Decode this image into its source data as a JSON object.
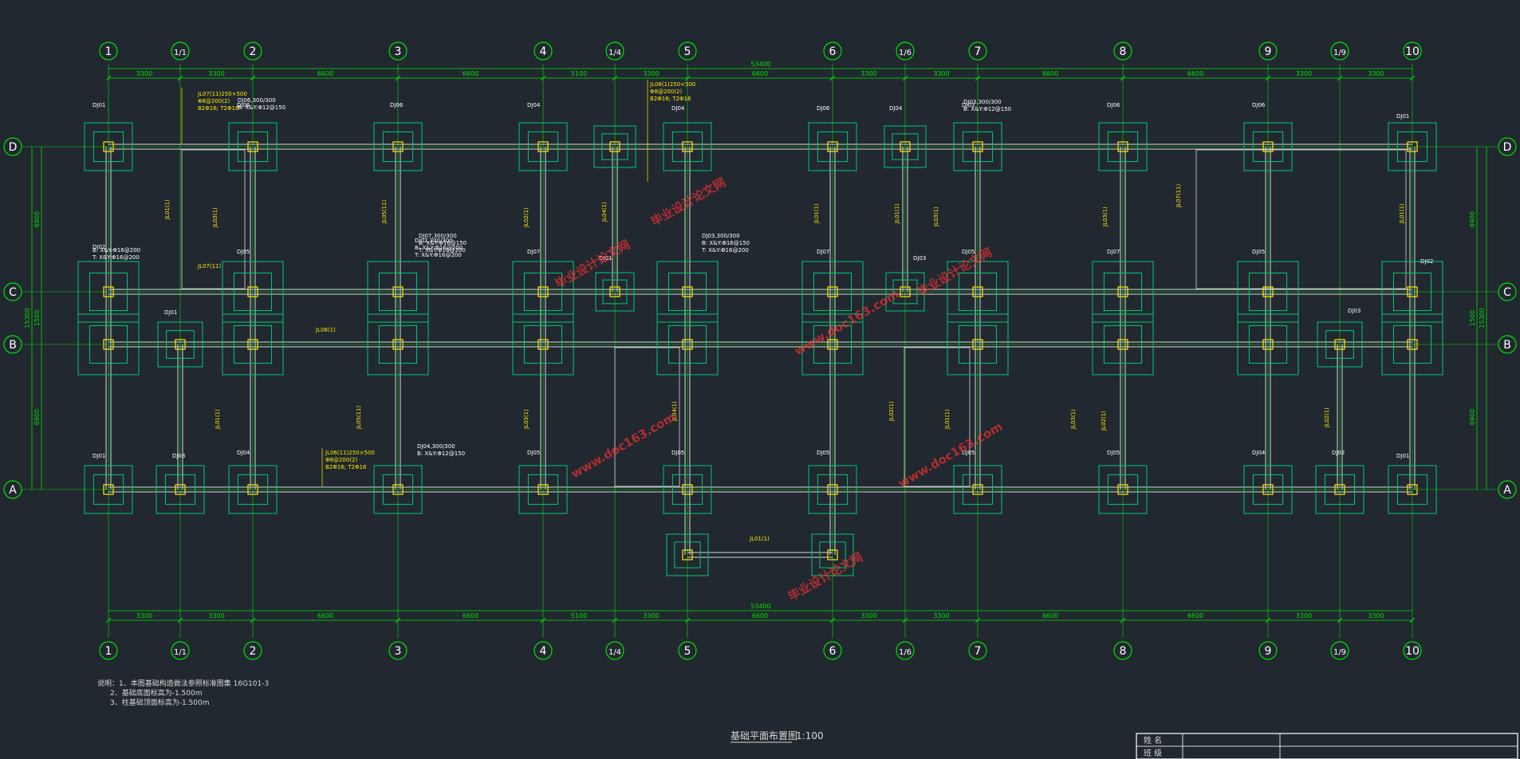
{
  "drawing": {
    "title": "基础平面布置图",
    "scale": "1:100",
    "notes": [
      "说明：1、本图基础构造做法参照标准图集 16G101-3",
      "2、基础底面标高为-1.500m",
      "3、柱基础顶面标高为-1.500m"
    ],
    "title_block": [
      "姓 名",
      "班 级"
    ],
    "watermarks": [
      "毕业设计论文网",
      "www.doc163.com"
    ]
  },
  "axes": {
    "columns": [
      "1",
      "1/1",
      "2",
      "3",
      "4",
      "1/4",
      "5",
      "6",
      "1/6",
      "7",
      "8",
      "9",
      "1/9",
      "10"
    ],
    "rows": [
      "D",
      "C",
      "B",
      "A"
    ]
  },
  "dimensions": {
    "total": "53400",
    "spans": [
      "3300",
      "3300",
      "6600",
      "6600",
      "5100",
      "3300",
      "6600",
      "3300",
      "3300",
      "6600",
      "6600",
      "3300",
      "3300"
    ],
    "row_spans": [
      "6900",
      "1500",
      "6900"
    ],
    "row_total": "15300"
  },
  "labels": {
    "footings": [
      "DJ01",
      "DJ02",
      "DJ03",
      "DJ04",
      "DJ05",
      "DJ06",
      "DJ07",
      "DJ08"
    ],
    "beams": [
      "JL01(1)",
      "JL02(1)",
      "JL03(1)",
      "JL04(1)",
      "JL05(11)",
      "JL06(11)",
      "JL07(11)",
      "JL08(1)"
    ],
    "callouts": [
      "JL07(11)250×500",
      "Φ8@200(2)",
      "B2Φ16; T2Φ16",
      "DJ06,300/300",
      "B: X&Y:Φ12@150",
      "DJ07,300/300",
      "B: X&Y:Φ16@150",
      "T: X&Y:Φ16@200",
      "DJ03,300/300",
      "JL08(1)250×500",
      "JL06(11)250×500",
      "DJ04,300/300",
      "B: X&Y:Φ12@150",
      "DJ08,300/300",
      "B: X&Y:Φ12@150",
      "DJ02,300/300",
      "B: X&Y:Φ16@200",
      "T: X&Y:Φ16@200"
    ]
  },
  "colors": {
    "background": "#212830",
    "axis": "#00e000",
    "foundation": "#00c878",
    "text_yellow": "#ffe800",
    "wall": "#d8d8d8",
    "watermark": "#ff3030"
  }
}
